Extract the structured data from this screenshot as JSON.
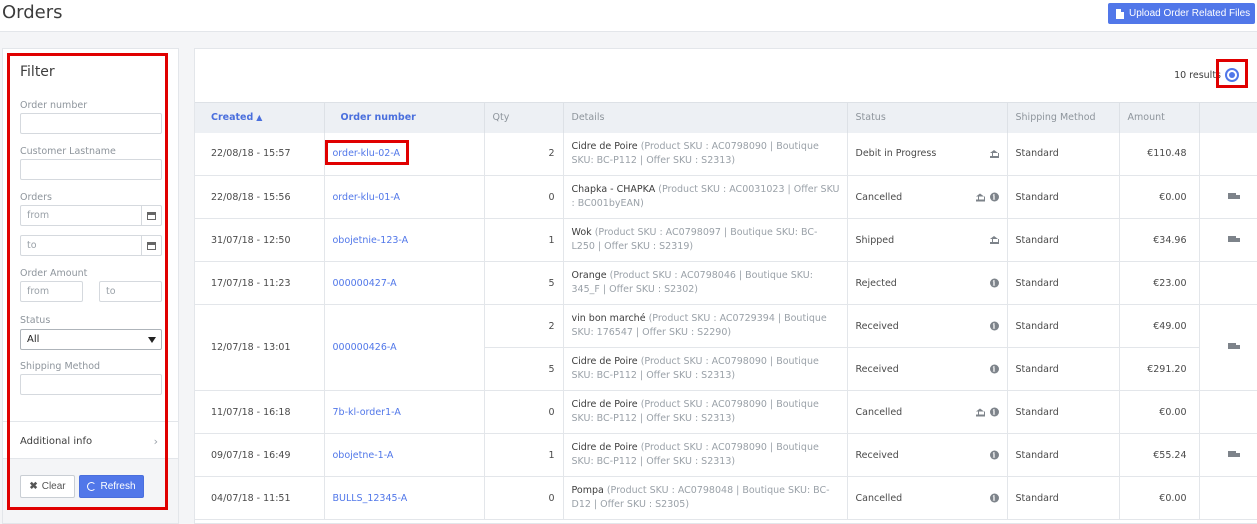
{
  "header": {
    "title": "Orders",
    "upload_label": "Upload Order Related Files"
  },
  "filter": {
    "title": "Filter",
    "order_number_label": "Order number",
    "customer_lastname_label": "Customer Lastname",
    "orders_label": "Orders",
    "orders_from_placeholder": "from",
    "orders_to_placeholder": "to",
    "order_amount_label": "Order Amount",
    "amount_from_placeholder": "from",
    "amount_to_placeholder": "to",
    "status_label": "Status",
    "status_value": "All",
    "shipping_method_label": "Shipping Method",
    "additional_info_label": "Additional info",
    "clear_label": "Clear",
    "refresh_label": "Refresh"
  },
  "results": {
    "count_text": "10 results"
  },
  "table": {
    "columns": [
      "Created",
      "Order number",
      "Qty",
      "Details",
      "Status",
      "Shipping Method",
      "Amount"
    ],
    "rows": [
      {
        "created": "22/08/18 - 15:57",
        "order": "order-klu-02-A",
        "qty": "2",
        "name": "Cidre de Poire",
        "sku": "(Product SKU : AC0798090 | Boutique SKU: BC-P112 | Offer SKU : S2313)",
        "status": "Debit in Progress",
        "icons": [
          "bank-icon"
        ],
        "shipping": "Standard",
        "amount": "€110.48",
        "truck": false
      },
      {
        "created": "22/08/18 - 15:56",
        "order": "order-klu-01-A",
        "qty": "0",
        "name": "Chapka - CHAPKA",
        "sku": "(Product SKU : AC0031023 | Offer SKU : BC001byEAN)",
        "status": "Cancelled",
        "icons": [
          "bank-icon",
          "info-icon"
        ],
        "shipping": "Standard",
        "amount": "€0.00",
        "truck": true
      },
      {
        "created": "31/07/18 - 12:50",
        "order": "obojetnie-123-A",
        "qty": "1",
        "name": "Wok",
        "sku": "(Product SKU : AC0798097 | Boutique SKU: BC-L250 | Offer SKU : S2319)",
        "status": "Shipped",
        "icons": [
          "bank-icon"
        ],
        "shipping": "Standard",
        "amount": "€34.96",
        "truck": true
      },
      {
        "created": "17/07/18 - 11:23",
        "order": "000000427-A",
        "qty": "5",
        "name": "Orange",
        "sku": "(Product SKU : AC0798046 | Boutique SKU: 345_F | Offer SKU : S2302)",
        "status": "Rejected",
        "icons": [
          "info-icon"
        ],
        "shipping": "Standard",
        "amount": "€23.00",
        "truck": false
      },
      {
        "created": "12/07/18 - 13:01",
        "order": "000000426-A",
        "lines": [
          {
            "qty": "2",
            "name": "vin bon marché",
            "sku": "(Product SKU : AC0729394 | Boutique SKU: 176547 | Offer SKU : S2290)",
            "status": "Received",
            "icons": [
              "info-icon"
            ],
            "shipping": "Standard",
            "amount": "€49.00"
          },
          {
            "qty": "5",
            "name": "Cidre de Poire",
            "sku": "(Product SKU : AC0798090 | Boutique SKU: BC-P112 | Offer SKU : S2313)",
            "status": "Received",
            "icons": [
              "info-icon"
            ],
            "shipping": "Standard",
            "amount": "€291.20"
          }
        ],
        "truck": true
      },
      {
        "created": "11/07/18 - 16:18",
        "order": "7b-kl-order1-A",
        "qty": "0",
        "name": "Cidre de Poire",
        "sku": "(Product SKU : AC0798090 | Boutique SKU: BC-P112 | Offer SKU : S2313)",
        "status": "Cancelled",
        "icons": [
          "bank-icon",
          "info-icon"
        ],
        "shipping": "Standard",
        "amount": "€0.00",
        "truck": false
      },
      {
        "created": "09/07/18 - 16:49",
        "order": "obojetne-1-A",
        "qty": "1",
        "name": "Cidre de Poire",
        "sku": "(Product SKU : AC0798090 | Boutique SKU: BC-P112 | Offer SKU : S2313)",
        "status": "Received",
        "icons": [
          "info-icon"
        ],
        "shipping": "Standard",
        "amount": "€55.24",
        "truck": true
      },
      {
        "created": "04/07/18 - 11:51",
        "order": "BULLS_12345-A",
        "qty": "0",
        "name": "Pompa",
        "sku": "(Product SKU : AC0798048 | Boutique SKU: BC-D12 | Offer SKU : S2305)",
        "status": "Cancelled",
        "icons": [
          "info-icon"
        ],
        "shipping": "Standard",
        "amount": "€0.00",
        "truck": false
      }
    ]
  },
  "colors": {
    "accent": "#5177e9",
    "highlight_box": "#e00000"
  }
}
